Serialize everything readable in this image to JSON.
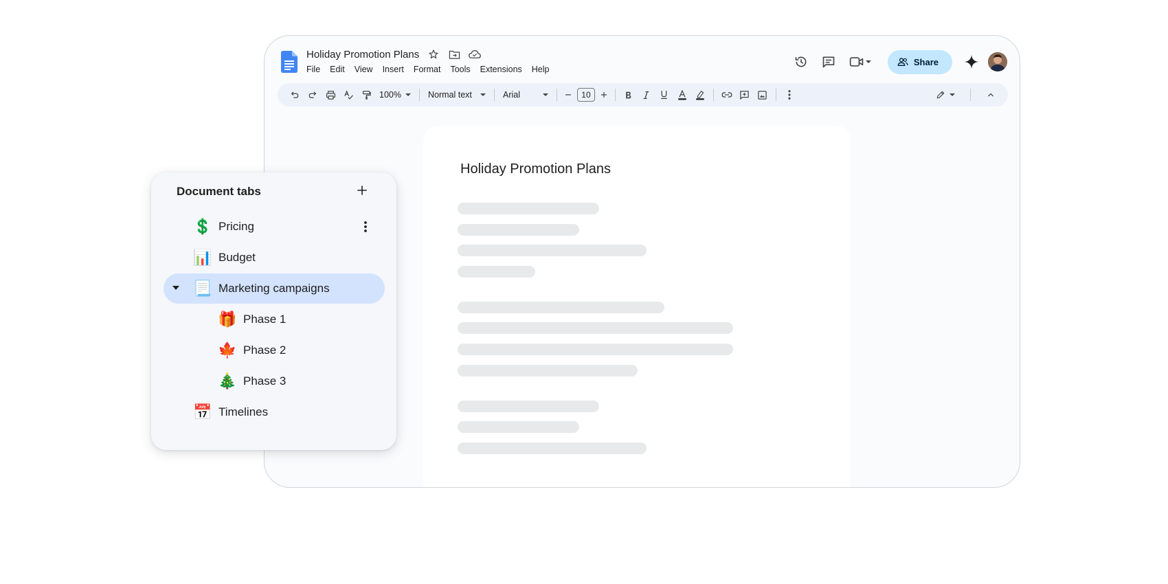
{
  "document": {
    "title": "Holiday Promotion Plans",
    "menu": [
      "File",
      "Edit",
      "View",
      "Insert",
      "Format",
      "Tools",
      "Extensions",
      "Help"
    ],
    "share_label": "Share"
  },
  "toolbar": {
    "zoom": "100%",
    "style": "Normal text",
    "font": "Arial",
    "font_size": "10"
  },
  "page": {
    "heading": "Holiday Promotion Plans"
  },
  "tabs_panel": {
    "title": "Document tabs",
    "tabs": [
      {
        "emoji": "💲",
        "label": "Pricing"
      },
      {
        "emoji": "📊",
        "label": "Budget"
      },
      {
        "emoji": "📃",
        "label": "Marketing campaigns"
      },
      {
        "emoji": "🎁",
        "label": "Phase 1"
      },
      {
        "emoji": "🍁",
        "label": "Phase 2"
      },
      {
        "emoji": "🎄",
        "label": "Phase 3"
      },
      {
        "emoji": "📅",
        "label": "Timelines"
      }
    ]
  },
  "colors": {
    "share_bg": "#c2e7ff",
    "active_tab_bg": "#d3e3fd",
    "docs_blue": "#4285f4"
  }
}
